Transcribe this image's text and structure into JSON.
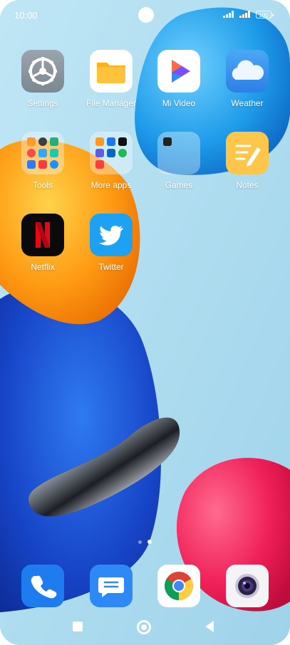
{
  "status": {
    "time": "10:00",
    "battery": "100"
  },
  "apps": {
    "settings": "Settings",
    "file_manager": "File Manager",
    "mi_video": "Mi Video",
    "weather": "Weather",
    "tools": "Tools",
    "more_apps": "More apps",
    "games": "Games",
    "notes": "Notes",
    "netflix": "Netflix",
    "twitter": "Twitter"
  },
  "dock": [
    "phone-icon",
    "messages-icon",
    "chrome-icon",
    "camera-icon"
  ],
  "page_indicator": {
    "pages": 2,
    "current": 2
  },
  "colors": {
    "wallpaper_bg": "#a9d9ee",
    "blue_blob": "#1e5bd6",
    "orange_blob": "#ff9a1a",
    "pink_blob": "#f2245a"
  }
}
